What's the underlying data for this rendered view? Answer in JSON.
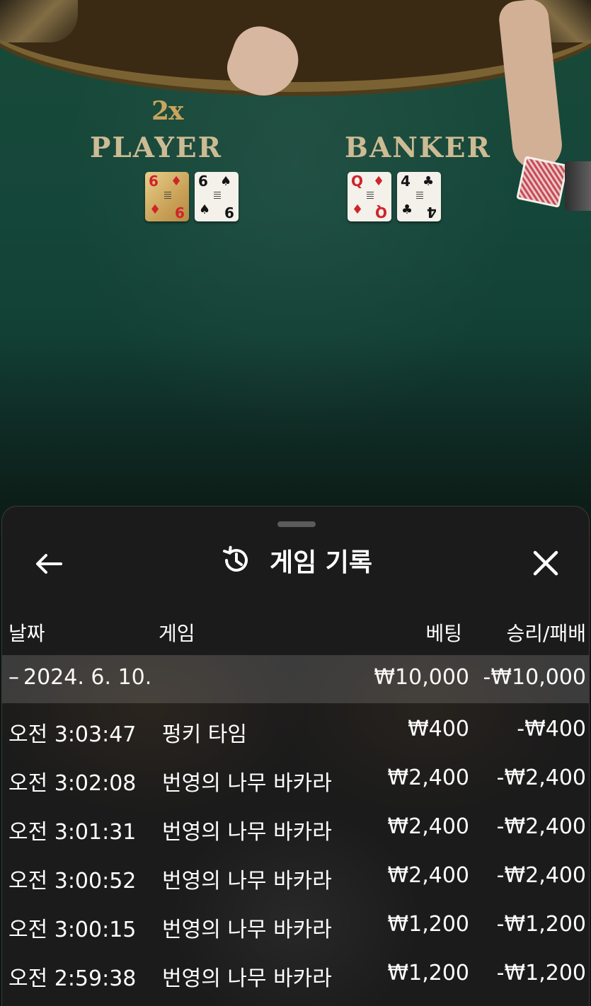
{
  "live_table": {
    "multiplier": "2x",
    "player_label": "PLAYER",
    "banker_label": "BANKER",
    "player_cards": [
      {
        "rank": "6",
        "suit": "♦",
        "rank_bottom": "9",
        "suit_bottom": "♦",
        "color": "red",
        "style": "gold"
      },
      {
        "rank": "6",
        "suit": "♠",
        "rank_bottom": "9",
        "suit_bottom": "♠",
        "color": "black",
        "style": "white"
      }
    ],
    "banker_cards": [
      {
        "rank": "Q",
        "suit": "♦",
        "rank_bottom": "Q",
        "suit_bottom": "♦",
        "color": "red",
        "style": "white"
      },
      {
        "rank": "4",
        "suit": "♣",
        "rank_bottom": "4",
        "suit_bottom": "♣",
        "color": "black",
        "style": "white"
      }
    ]
  },
  "history": {
    "title": "게임 기록",
    "icons": {
      "back": "arrow-left-icon",
      "title": "history-clock-icon",
      "close": "close-icon"
    },
    "columns": {
      "date": "날짜",
      "game": "게임",
      "bet": "베팅",
      "result": "승리/패배"
    },
    "date_group": {
      "toggle": "–",
      "date": "2024. 6. 10.",
      "bet_total": "₩10,000",
      "result_total": "-₩10,000"
    },
    "rows": [
      {
        "time": "오전 3:03:47",
        "game": "펑키 타임",
        "bet": "₩400",
        "result": "-₩400"
      },
      {
        "time": "오전 3:02:08",
        "game": "번영의 나무 바카라",
        "bet": "₩2,400",
        "result": "-₩2,400"
      },
      {
        "time": "오전 3:01:31",
        "game": "번영의 나무 바카라",
        "bet": "₩2,400",
        "result": "-₩2,400"
      },
      {
        "time": "오전 3:00:52",
        "game": "번영의 나무 바카라",
        "bet": "₩2,400",
        "result": "-₩2,400"
      },
      {
        "time": "오전 3:00:15",
        "game": "번영의 나무 바카라",
        "bet": "₩1,200",
        "result": "-₩1,200"
      },
      {
        "time": "오전 2:59:38",
        "game": "번영의 나무 바카라",
        "bet": "₩1,200",
        "result": "-₩1,200"
      }
    ]
  },
  "colors": {
    "sheet_bg": "#1b1b1b",
    "date_group_bg": "#3c3c3c",
    "felt": "#15463a",
    "text": "#ffffff"
  }
}
